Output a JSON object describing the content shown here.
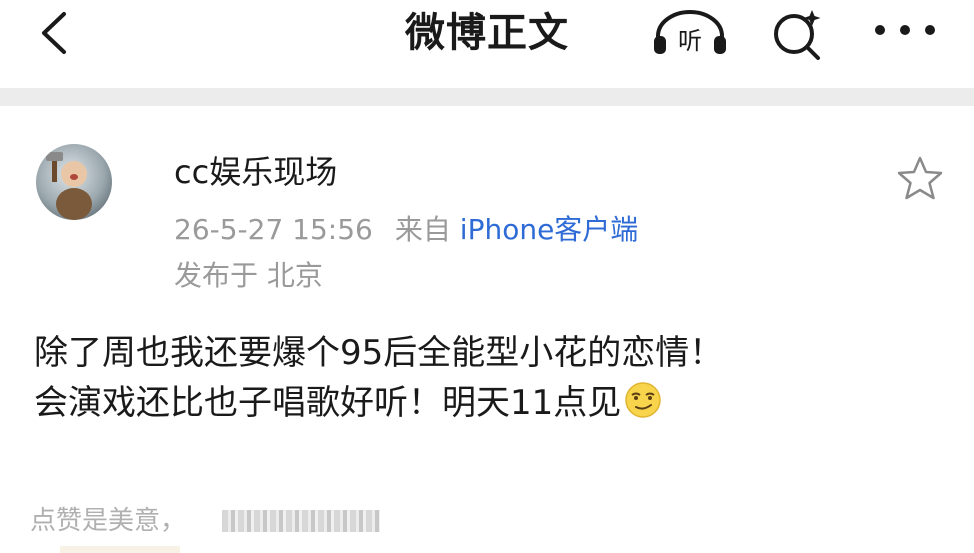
{
  "header": {
    "title": "微博正文",
    "listen_label": "听",
    "icons": {
      "back": "chevron-left-icon",
      "listen": "headphones-icon",
      "search": "search-sparkle-icon",
      "more": "more-dots-icon"
    }
  },
  "post": {
    "username": "cc娱乐现场",
    "timestamp": "26-5-27 15:56",
    "source_prefix": "来自",
    "source": "iPhone客户端",
    "location": "发布于 北京",
    "body_lines": [
      "除了周也我还要爆个95后全能型小花的恋情！",
      "会演戏还比也子唱歌好听！明天11点见"
    ],
    "emoji": "smirk-emoji-icon",
    "favorite_icon": "star-outline-icon"
  },
  "footer": {
    "hint": "点赞是美意，"
  },
  "colors": {
    "meta_gray": "#9a9a9a",
    "link_blue": "#2f6bd6",
    "band_gray": "#ececec"
  }
}
